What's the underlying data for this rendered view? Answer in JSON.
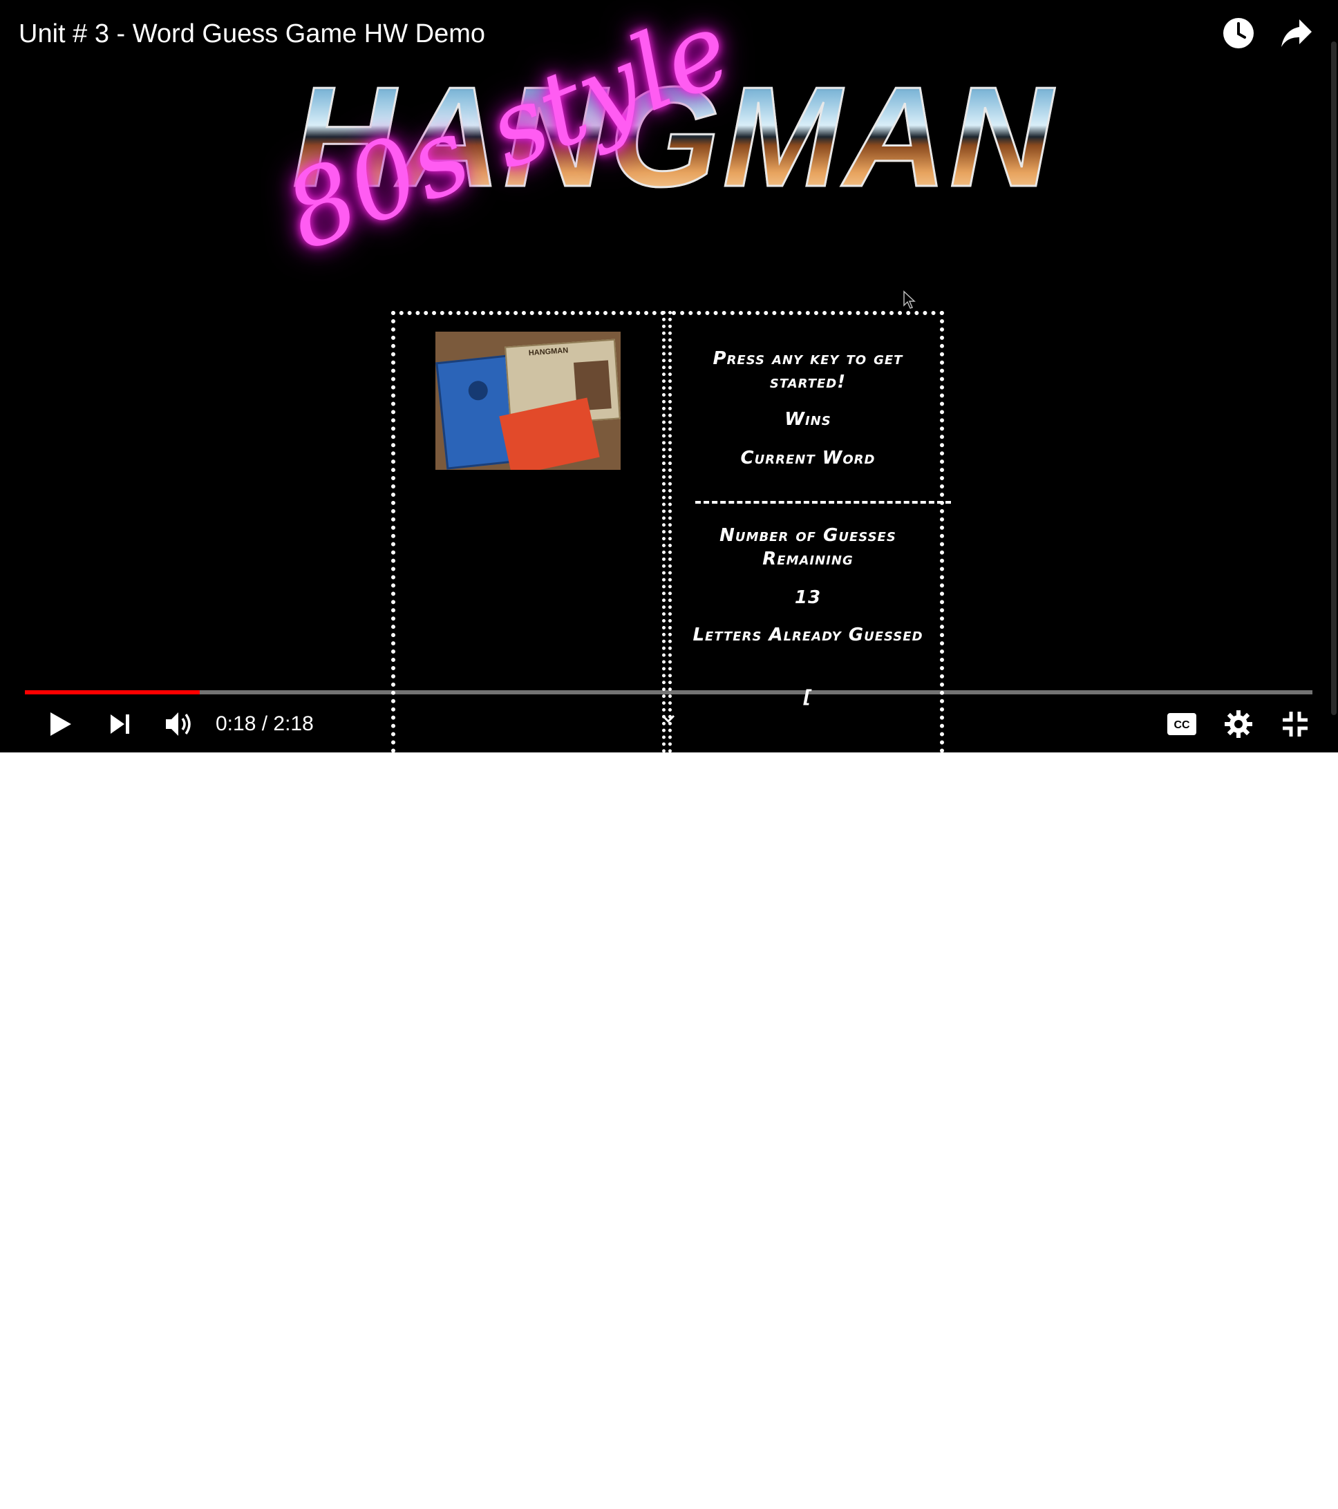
{
  "player": {
    "title": "Unit # 3 - Word Guess Game HW Demo",
    "top_icons": [
      "watch-later-icon",
      "share-icon"
    ],
    "progress": {
      "played_fraction": 0.136,
      "current_time": "0:18",
      "duration": "2:18",
      "time_display": "0:18 / 2:18",
      "played_color": "#ff0000"
    },
    "controls_left": [
      "play-icon",
      "next-icon",
      "volume-icon"
    ],
    "controls_right": [
      "captions-icon",
      "settings-icon",
      "exit-fullscreen-icon"
    ]
  },
  "video_frame": {
    "logo": {
      "main_text": "HANGMAN",
      "script_text": "80s style"
    },
    "game": {
      "prompt": "Press any key to get started!",
      "wins_label": "Wins",
      "current_word_label": "Current Word",
      "guesses_label": "Number of Guesses Remaining",
      "guesses_value": "13",
      "letters_label": "Letters Already Guessed",
      "letters_value": "[",
      "photo": "hangman-board-game-photo"
    },
    "colors": {
      "background": "#000000",
      "neon_pink": "#ff5cf2",
      "text": "#ffffff"
    }
  }
}
